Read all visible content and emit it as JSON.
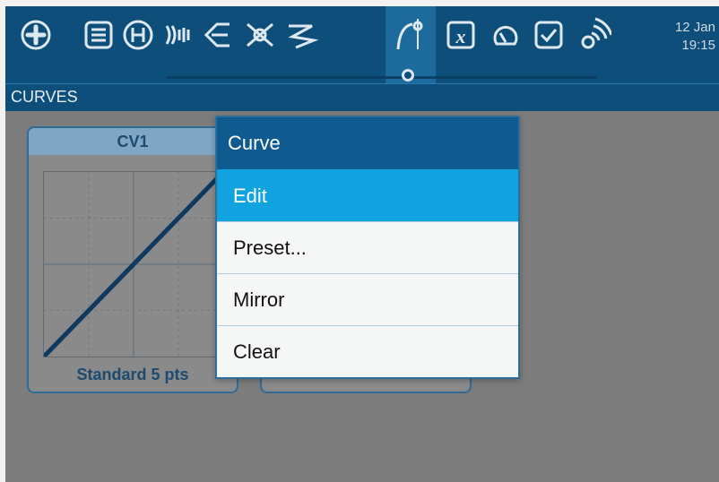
{
  "topbar": {
    "icons": [
      "add-circle-icon",
      "list-icon",
      "heli-icon",
      "sound-waves-icon",
      "arrow-left-icon",
      "mixer-cross-icon",
      "wave-glider-icon",
      "curve-icon",
      "x-box-icon",
      "cloud-gauge-icon",
      "checkbox-icon",
      "wireless-icon"
    ],
    "date": "12 Jan",
    "time": "19:15"
  },
  "page": {
    "title": "CURVES"
  },
  "cards": [
    {
      "title": "CV1",
      "caption": "Standard 5 pts"
    }
  ],
  "menu": {
    "title": "Curve",
    "items": [
      {
        "label": "Edit",
        "selected": true
      },
      {
        "label": "Preset..."
      },
      {
        "label": "Mirror"
      },
      {
        "label": "Clear"
      }
    ]
  },
  "chart_data": {
    "type": "line",
    "x": [
      -100,
      -50,
      0,
      50,
      100
    ],
    "series": [
      {
        "values": [
          -100,
          -50,
          0,
          50,
          100
        ]
      }
    ],
    "xlim": [
      -100,
      100
    ],
    "ylim": [
      -100,
      100
    ]
  },
  "colors": {
    "topbar": "#0d4e7a",
    "accent": "#11a3e0",
    "menu_header": "#0f5a8f",
    "curve": "#0e3a5f"
  }
}
